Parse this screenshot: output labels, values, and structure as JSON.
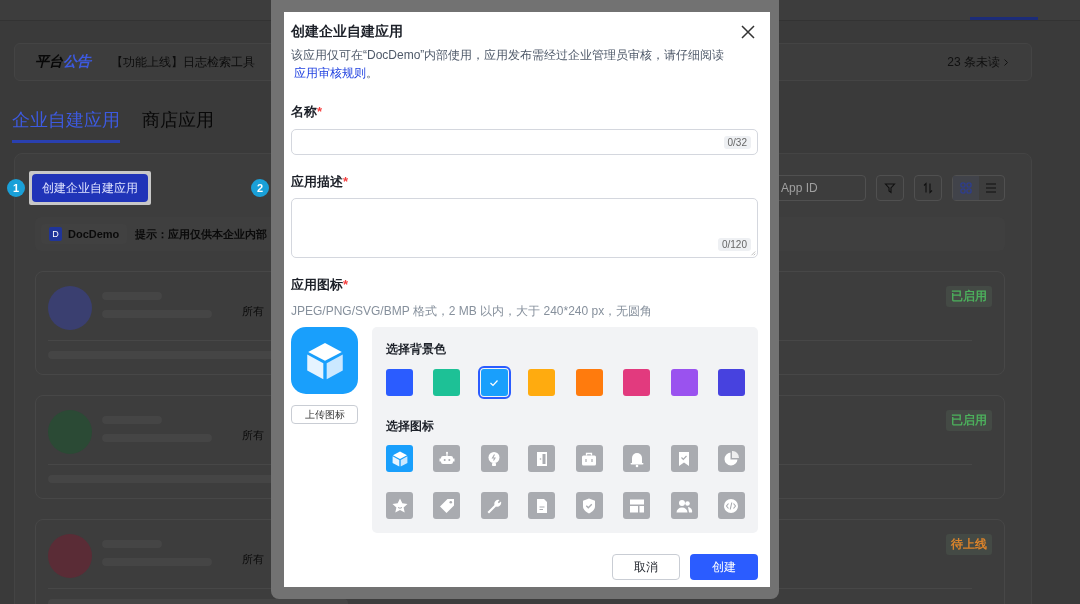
{
  "page": {
    "announcement": {
      "title_plain": "平台",
      "title_accent": "公告",
      "text": "【功能上线】日志检索工具",
      "unread": "23 条未读"
    },
    "tabs": [
      {
        "label": "企业自建应用",
        "selected": true
      },
      {
        "label": "商店应用",
        "selected": false
      }
    ],
    "toolbar": {
      "create_button": "创建企业自建应用",
      "steps": [
        "1",
        "2"
      ],
      "search": {
        "placeholder": "App ID"
      },
      "view_modes": [
        {
          "kind": "grid",
          "selected": true
        },
        {
          "kind": "list",
          "selected": false
        }
      ]
    },
    "org_chip": {
      "badge": "D",
      "name": "DocDemo"
    },
    "hint": "提示：应用仅供本企业内部",
    "apps": [
      {
        "avatar": {
          "color": "#3a3f70"
        },
        "scope": "所有",
        "status": "已启用",
        "color": "#4caf5c"
      },
      {
        "avatar": {
          "color": "#2b4a35"
        },
        "scope": "所有",
        "status": "已启用",
        "color": "#4caf5c"
      },
      {
        "avatar": {
          "color": "#5a2c36"
        },
        "scope": "所有",
        "status": "待上线",
        "color": "#d9822b"
      }
    ]
  },
  "dialog": {
    "title": "创建企业自建应用",
    "description": "该应用仅可在“DocDemo”内部使用，应用发布需经过企业管理员审核，请仔细阅读",
    "rules_link": "应用审核规则",
    "period": "。",
    "fields": [
      {
        "kind": "input",
        "label": "名称",
        "required_mark": "*",
        "counter": "0/32"
      },
      {
        "kind": "textarea",
        "label": "应用描述",
        "required_mark": "*",
        "counter": "0/120"
      }
    ],
    "icon_section": {
      "label": "应用图标",
      "required_mark": "*",
      "hint": "JPEG/PNG/SVG/BMP 格式，2 MB 以内，大于 240*240 px，无圆角",
      "upload_button": "上传图标",
      "colors_label": "选择背景色",
      "colors": [
        {
          "color": "#2b5cff",
          "selected": false
        },
        {
          "color": "#1dc196",
          "selected": false
        },
        {
          "color": "#199ffc",
          "selected": true
        },
        {
          "color": "#ffab0f",
          "selected": false
        },
        {
          "color": "#ff7b0d",
          "selected": false
        },
        {
          "color": "#e23a7e",
          "selected": false
        },
        {
          "color": "#9a52ef",
          "selected": false
        },
        {
          "color": "#4742df",
          "selected": false
        }
      ],
      "icons_label": "选择图标",
      "icons": [
        {
          "kind": "cube",
          "selected": true
        },
        {
          "kind": "robot",
          "selected": false
        },
        {
          "kind": "lightbulb",
          "selected": false
        },
        {
          "kind": "door",
          "selected": false
        },
        {
          "kind": "briefcase",
          "selected": false
        },
        {
          "kind": "bell",
          "selected": false
        },
        {
          "kind": "bookmark",
          "selected": false
        },
        {
          "kind": "pie",
          "selected": false
        },
        {
          "kind": "star",
          "selected": false
        },
        {
          "kind": "tag",
          "selected": false
        },
        {
          "kind": "wrench",
          "selected": false
        },
        {
          "kind": "document",
          "selected": false
        },
        {
          "kind": "shield",
          "selected": false
        },
        {
          "kind": "layout",
          "selected": false
        },
        {
          "kind": "people",
          "selected": false
        },
        {
          "kind": "code",
          "selected": false
        }
      ]
    },
    "buttons": [
      {
        "kind": "secondary",
        "label": "取消"
      },
      {
        "kind": "primary",
        "label": "创建"
      }
    ]
  }
}
